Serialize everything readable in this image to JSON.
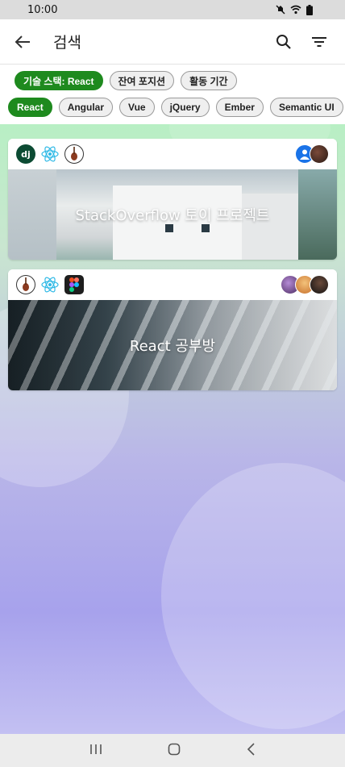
{
  "status": {
    "time": "10:00"
  },
  "header": {
    "title": "검색"
  },
  "filters": [
    {
      "label": "기술 스택: React",
      "active": true
    },
    {
      "label": "잔여 포지션",
      "active": false
    },
    {
      "label": "활동 기간",
      "active": false
    }
  ],
  "stacks": [
    {
      "label": "React",
      "active": true
    },
    {
      "label": "Angular",
      "active": false
    },
    {
      "label": "Vue",
      "active": false
    },
    {
      "label": "jQuery",
      "active": false
    },
    {
      "label": "Ember",
      "active": false
    },
    {
      "label": "Semantic UI",
      "active": false
    }
  ],
  "cards": [
    {
      "title": "StackOverflow 토이 프로젝트",
      "tech_icons": [
        "django-icon",
        "react-icon",
        "guitar-icon"
      ]
    },
    {
      "title": "React 공부방",
      "tech_icons": [
        "guitar-icon",
        "react-icon",
        "figma-icon"
      ]
    }
  ],
  "colors": {
    "accent": "#1e8a1e",
    "react": "#2fb9e6",
    "django": "#0c4b33"
  }
}
